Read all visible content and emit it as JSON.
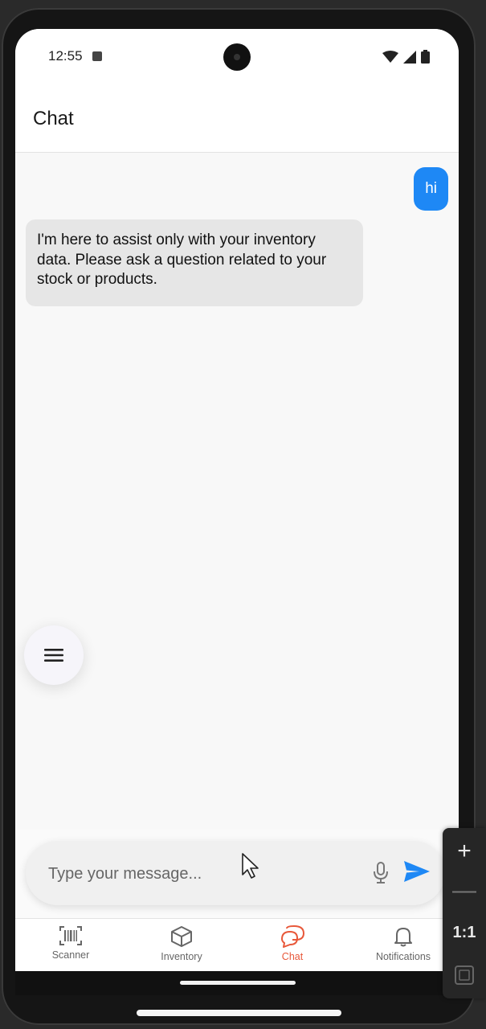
{
  "status_bar": {
    "time": "12:55"
  },
  "header": {
    "title": "Chat"
  },
  "messages": [
    {
      "role": "user",
      "text": "hi"
    },
    {
      "role": "assistant",
      "text": "I'm here to assist only with your inventory data. Please ask a question related to your stock or products."
    }
  ],
  "composer": {
    "placeholder": "Type your message..."
  },
  "bottom_nav": {
    "items": [
      {
        "label": "Scanner",
        "icon": "barcode-icon",
        "active": false
      },
      {
        "label": "Inventory",
        "icon": "box-icon",
        "active": false
      },
      {
        "label": "Chat",
        "icon": "chat-bubbles-icon",
        "active": true
      },
      {
        "label": "Notifications",
        "icon": "bell-icon",
        "active": false
      }
    ]
  },
  "emulator_controls": {
    "zoom_in": "+",
    "zoom_out": "—",
    "ratio": "1:1"
  },
  "colors": {
    "accent": "#1e88f5",
    "nav_active": "#e8583a",
    "bot_bubble": "#e6e6e6"
  }
}
